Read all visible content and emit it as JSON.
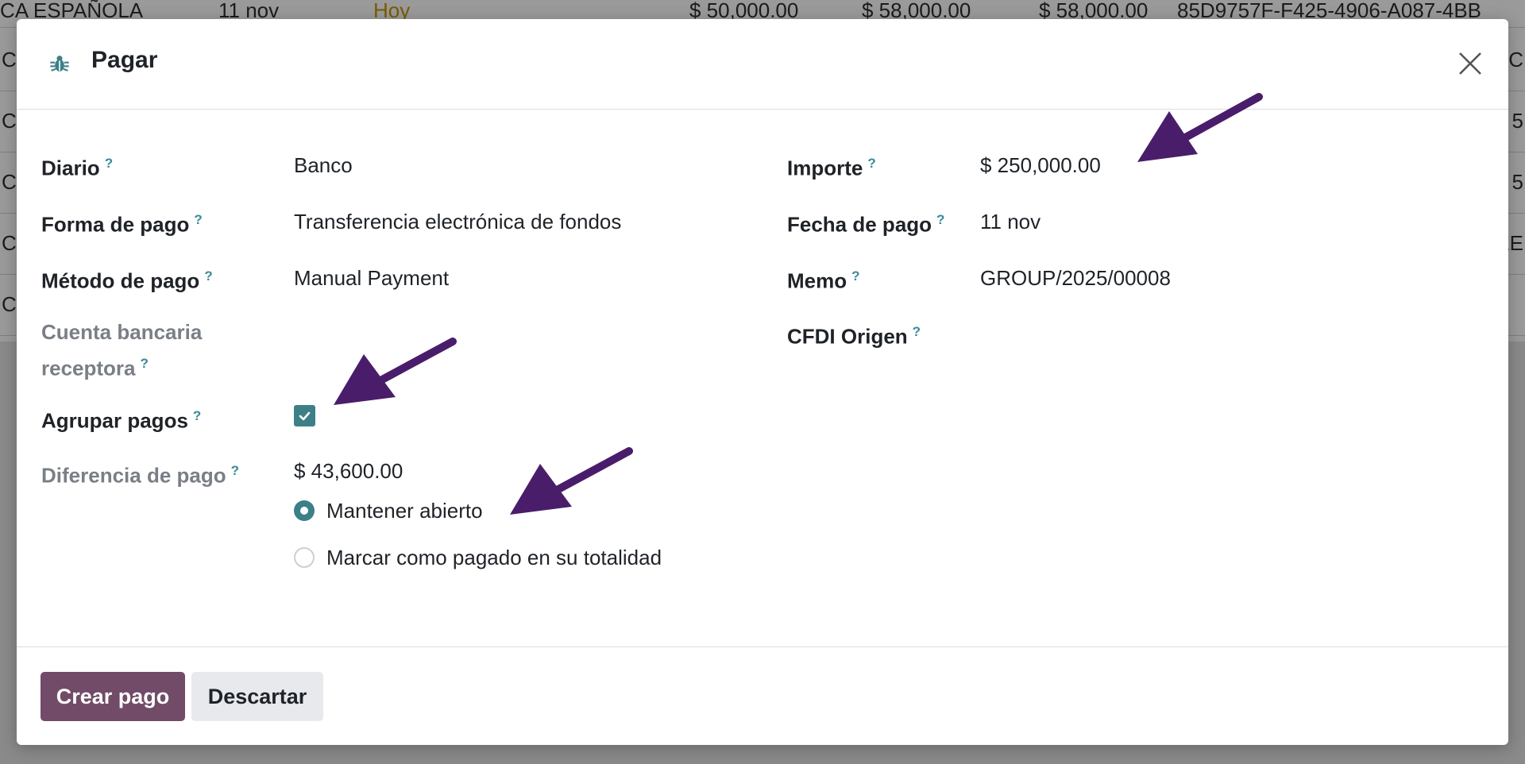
{
  "background": {
    "rows": [
      {
        "cells": [
          "CA ESPAÑOLA",
          "11 nov",
          "Hoy",
          "$ 50,000.00",
          "$ 58,000.00",
          "$ 58,000.00",
          "85D9757F-F425-4906-A087-4BB"
        ]
      },
      {
        "left": "C",
        "right": "AC"
      },
      {
        "left": "C",
        "right": "5"
      },
      {
        "left": "C",
        "right": "5"
      },
      {
        "left": "C",
        "right": "EE"
      },
      {
        "left": "C",
        "right": ""
      }
    ]
  },
  "modal": {
    "title": "Pagar",
    "left_fields": [
      {
        "label": "Diario",
        "help": "?",
        "value": "Banco"
      },
      {
        "label": "Forma de pago",
        "help": "?",
        "value": "Transferencia electrónica de fondos"
      },
      {
        "label": "Método de pago",
        "help": "?",
        "value": "Manual Payment"
      },
      {
        "label_line1": "Cuenta bancaria",
        "label_line2": "receptora",
        "help": "?",
        "value": ""
      },
      {
        "label": "Agrupar pagos",
        "help": "?",
        "checked": true
      },
      {
        "label": "Diferencia de pago",
        "help": "?",
        "value": "$ 43,600.00"
      }
    ],
    "right_fields": [
      {
        "label": "Importe",
        "help": "?",
        "value": "$ 250,000.00"
      },
      {
        "label": "Fecha de pago",
        "help": "?",
        "value": "11 nov"
      },
      {
        "label": "Memo",
        "help": "?",
        "value": "GROUP/2025/00008"
      },
      {
        "label": "CFDI Origen",
        "help": "?",
        "value": ""
      }
    ],
    "radio_options": [
      {
        "label": "Mantener abierto",
        "selected": true
      },
      {
        "label": "Marcar como pagado en su totalidad",
        "selected": false
      }
    ],
    "buttons": {
      "primary": "Crear pago",
      "secondary": "Descartar"
    }
  },
  "colors": {
    "primary": "#714b67",
    "accent": "#3d7f87",
    "annotation_arrow": "#4a1d6b"
  },
  "icons": {
    "title": "bug-icon",
    "close": "close-icon"
  }
}
